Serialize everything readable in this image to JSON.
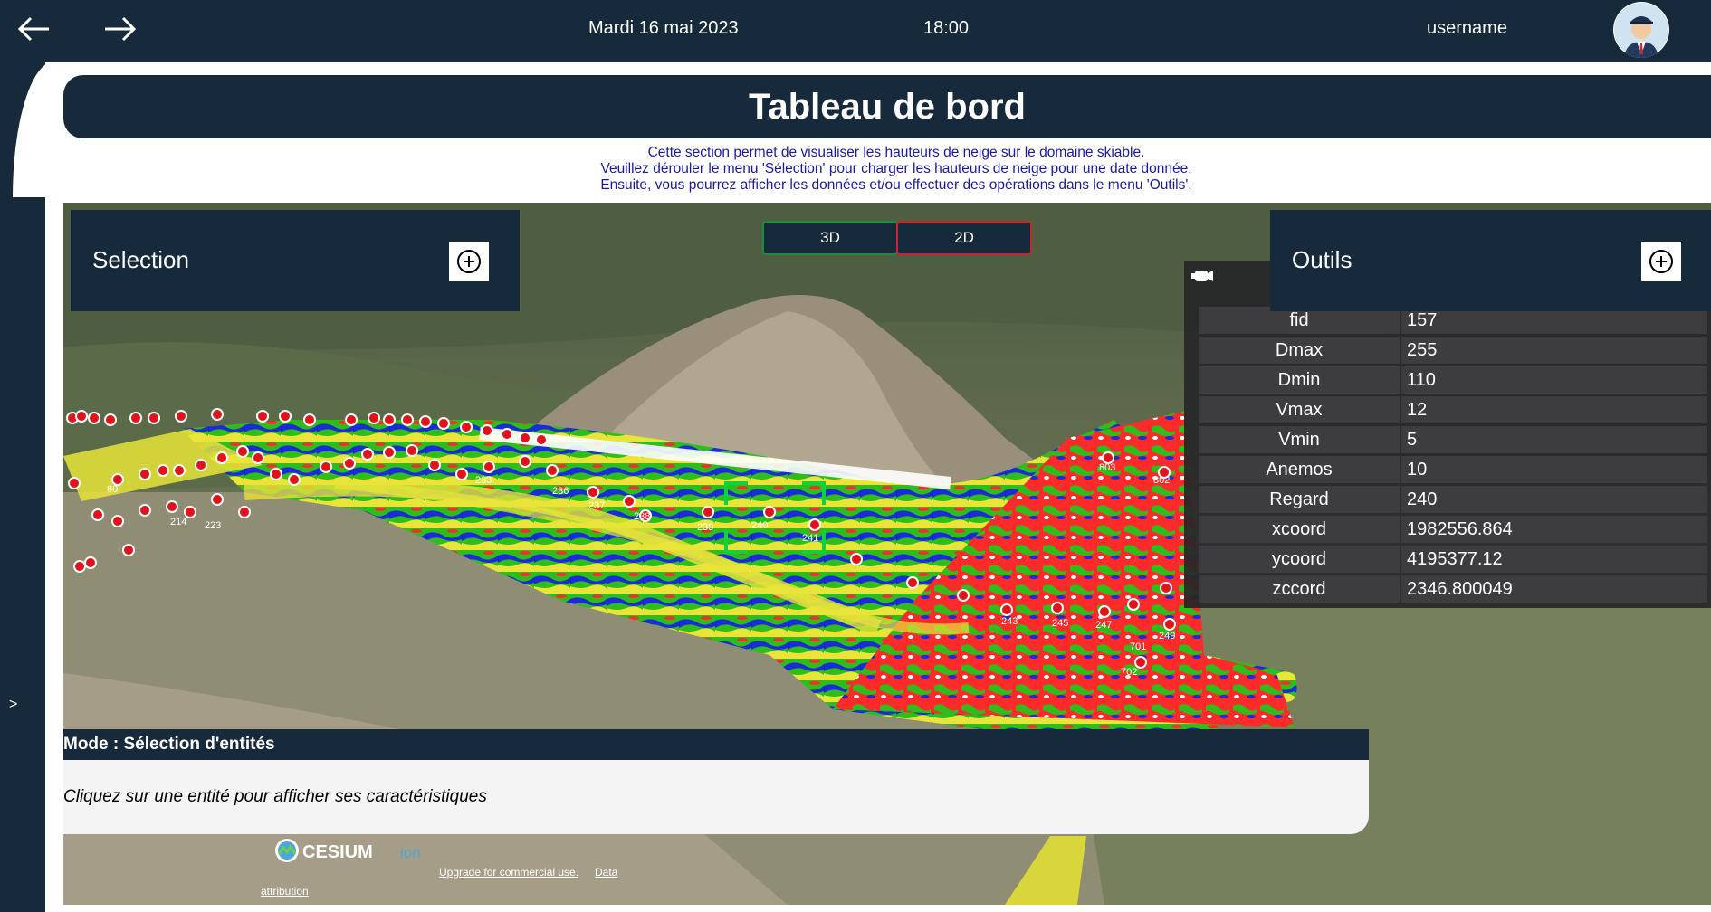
{
  "topbar": {
    "back_icon": "arrow-left-icon",
    "forward_icon": "arrow-right-icon",
    "date": "Mardi 16 mai 2023",
    "time": "18:00",
    "username": "username",
    "avatar_icon": "user-avatar-icon"
  },
  "sidebar": {
    "toggle_label": ">"
  },
  "page": {
    "title": "Tableau de bord",
    "intro": [
      "Cette section permet de visualiser les hauteurs de neige sur le domaine skiable.",
      "Veuillez dérouler le menu 'Sélection' pour charger les hauteurs de neige pour une date donnée.",
      "Ensuite, vous pourrez afficher les données et/ou effectuer des opérations dans le menu 'Outils'."
    ]
  },
  "map": {
    "selection_panel": {
      "title": "Selection",
      "icon": "plus-circle-icon"
    },
    "outils_panel": {
      "title": "Outils",
      "icon": "plus-circle-icon"
    },
    "view_toggle": {
      "btn_3d": "3D",
      "btn_2d": "2D"
    },
    "info_box": {
      "icon": "camera-icon",
      "rows": [
        {
          "key": "fid",
          "value": "157"
        },
        {
          "key": "Dmax",
          "value": "255"
        },
        {
          "key": "Dmin",
          "value": "110"
        },
        {
          "key": "Vmax",
          "value": "12"
        },
        {
          "key": "Vmin",
          "value": "5"
        },
        {
          "key": "Anemos",
          "value": "10"
        },
        {
          "key": "Regard",
          "value": "240"
        },
        {
          "key": "xcoord",
          "value": "1982556.864"
        },
        {
          "key": "ycoord",
          "value": "4195377.12"
        },
        {
          "key": "zccord",
          "value": "2346.800049"
        }
      ]
    },
    "mode_status": {
      "header": "Mode : Sélection d'entités",
      "body": "Cliquez sur une entité pour afficher ses caractéristiques"
    },
    "cesium": {
      "logo_text": "CESIUM",
      "logo_suffix": "ion",
      "upgrade": "Upgrade for commercial use.",
      "data": "Data",
      "attribution": "attribution"
    },
    "marker_labels": [
      "80",
      "214",
      "223",
      "233",
      "236",
      "237",
      "238",
      "239",
      "240",
      "241",
      "243",
      "245",
      "247",
      "249",
      "701",
      "702",
      "802",
      "803"
    ],
    "colors": {
      "dark_navy": "#172a3c",
      "marker_red": "#e0121a",
      "snow_red": "#ff2a2a",
      "snow_blue": "#1a2cd8",
      "snow_green": "#2ebd1a",
      "snow_yellow": "#e8e43a",
      "toggle_3d_border": "#1f8a3a",
      "toggle_2d_border": "#c0282b"
    }
  }
}
